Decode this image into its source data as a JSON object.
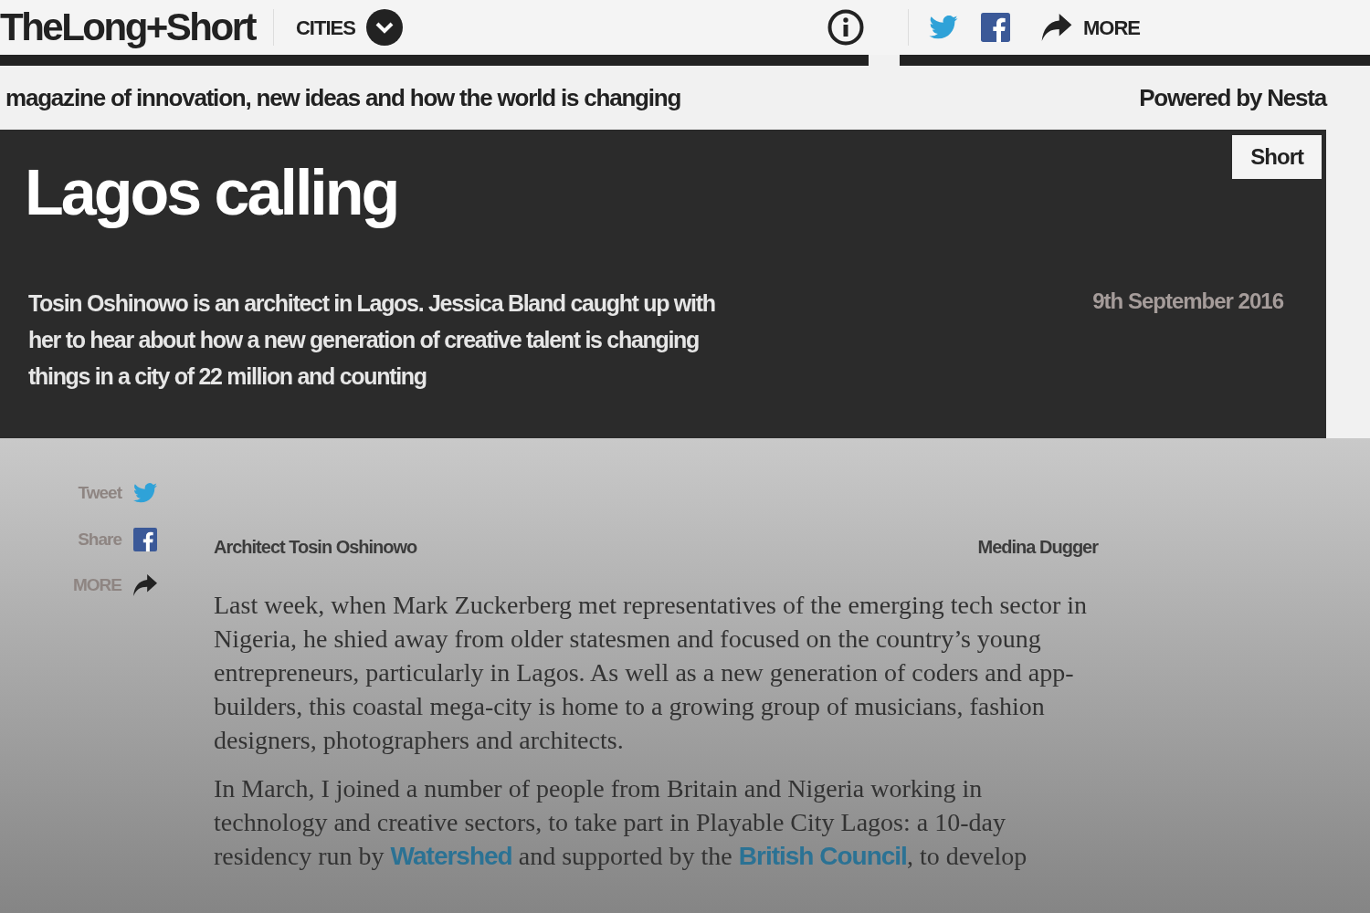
{
  "header": {
    "logo": "TheLong+Short",
    "section_menu": {
      "label": "CITIES"
    },
    "share": {
      "more": "MORE"
    }
  },
  "tagline": "magazine of innovation, new ideas and how the world is changing",
  "powered_by": "Powered by Nesta",
  "article": {
    "badge": "Short",
    "title": "Lagos calling",
    "standfirst": "Tosin Oshinowo is an architect in Lagos. Jessica Bland caught up with her to hear about how a new generation of creative talent is changing things in a city of 22 million and counting",
    "date": "9th September 2016"
  },
  "share_sidebar": [
    {
      "kind": "twitter",
      "label": "Tweet"
    },
    {
      "kind": "facebook",
      "label": "Share"
    },
    {
      "kind": "more",
      "label": "MORE"
    }
  ],
  "image_caption": "Architect Tosin Oshinowo",
  "image_credit": "Medina Dugger",
  "paragraphs": [
    [
      {
        "kind": "text",
        "text": "Last week, when Mark Zuckerberg met representatives of the emerging tech sector in Nigeria, he shied away from older statesmen and focused on the country’s young entrepreneurs, particularly in Lagos. As well as a new generation of coders and app-builders, this coastal mega-city is home to a growing group of musicians, fashion designers, photographers and architects."
      }
    ],
    [
      {
        "kind": "text",
        "text": "In March, I joined a number of people from Britain and Nigeria working in technology and creative sectors, to take part in Playable City Lagos: a 10-day residency run by "
      },
      {
        "kind": "link",
        "text": "Watershed"
      },
      {
        "kind": "text",
        "text": " and supported by the "
      },
      {
        "kind": "link",
        "text": "British Council"
      },
      {
        "kind": "text",
        "text": ", to develop"
      }
    ]
  ]
}
